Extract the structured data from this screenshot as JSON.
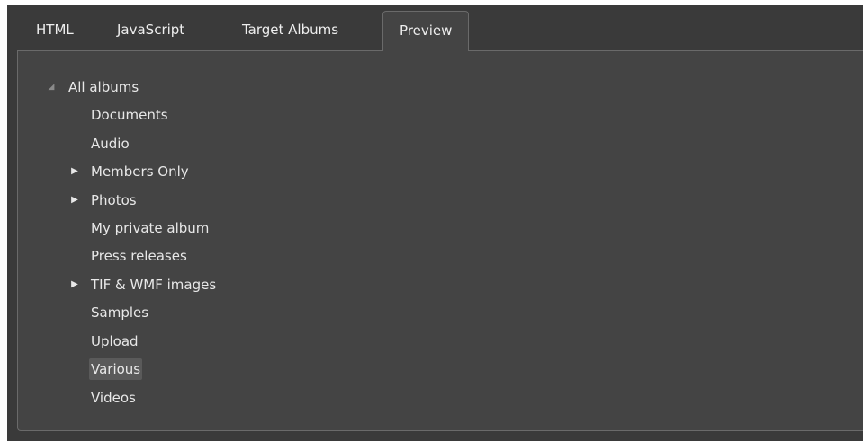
{
  "tabs": [
    {
      "label": "HTML"
    },
    {
      "label": "JavaScript"
    },
    {
      "label": "Target Albums"
    },
    {
      "label": "Preview"
    }
  ],
  "active_tab": "Preview",
  "tree": {
    "root": {
      "label": "All albums",
      "expanded": true
    },
    "children": [
      {
        "label": "Documents",
        "has_children": false
      },
      {
        "label": "Audio",
        "has_children": false
      },
      {
        "label": "Members Only",
        "has_children": true
      },
      {
        "label": "Photos",
        "has_children": true
      },
      {
        "label": "My private album",
        "has_children": false
      },
      {
        "label": "Press releases",
        "has_children": false
      },
      {
        "label": "TIF & WMF images",
        "has_children": true
      },
      {
        "label": "Samples",
        "has_children": false
      },
      {
        "label": "Upload",
        "has_children": false
      },
      {
        "label": "Various",
        "has_children": false,
        "selected": true
      },
      {
        "label": "Videos",
        "has_children": false
      }
    ]
  },
  "icons": {
    "expanded": "triangle-down-right-icon",
    "collapsed": "triangle-right-icon"
  },
  "colors": {
    "window_bg": "#3a3a3a",
    "panel_bg": "#444444",
    "border": "#6a6a6a",
    "text": "#e8e8e8",
    "selection": "#5a5a5a"
  }
}
